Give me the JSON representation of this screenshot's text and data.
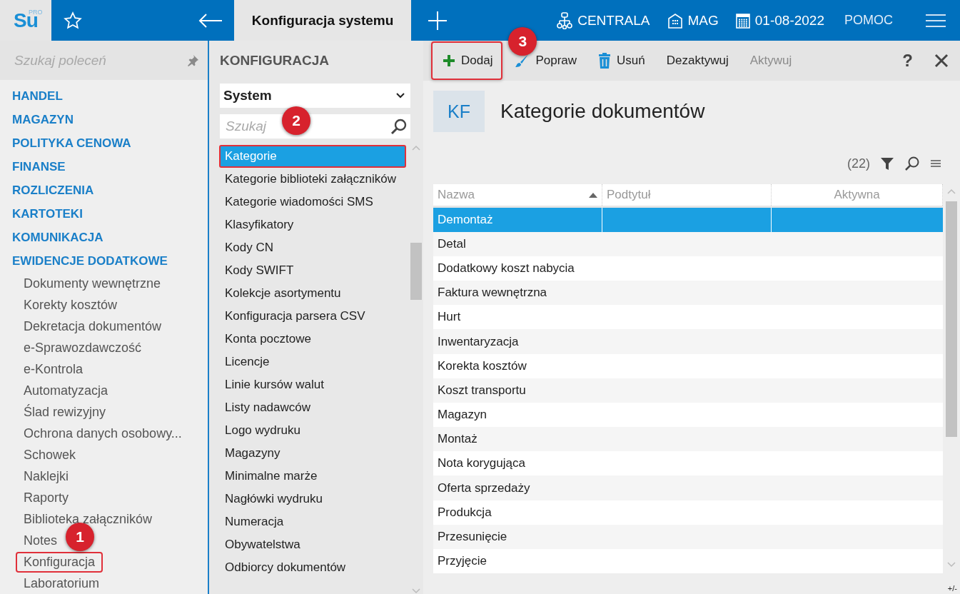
{
  "topbar": {
    "logo": "Su",
    "logo_sup": "PRO",
    "tab_title": "Konfiguracja systemu",
    "branch": "CENTRALA",
    "warehouse": "MAG",
    "date": "01-08-2022",
    "help": "POMOC"
  },
  "sidebar": {
    "search_placeholder": "Szukaj poleceń",
    "sections": [
      {
        "label": "HANDEL"
      },
      {
        "label": "MAGAZYN"
      },
      {
        "label": "POLITYKA CENOWA"
      },
      {
        "label": "FINANSE"
      },
      {
        "label": "ROZLICZENIA"
      },
      {
        "label": "KARTOTEKI"
      },
      {
        "label": "KOMUNIKACJA"
      },
      {
        "label": "EWIDENCJE DODATKOWE",
        "children": [
          {
            "label": "Dokumenty wewnętrzne",
            "outlined": false
          },
          {
            "label": "Korekty kosztów",
            "outlined": false
          },
          {
            "label": "Dekretacja dokumentów",
            "outlined": false
          },
          {
            "label": "e-Sprawozdawczość",
            "outlined": false
          },
          {
            "label": "e-Kontrola",
            "outlined": false
          },
          {
            "label": "Automatyzacja",
            "outlined": false
          },
          {
            "label": "Ślad rewizyjny",
            "outlined": false
          },
          {
            "label": "Ochrona danych osobowy...",
            "outlined": false
          },
          {
            "label": "Schowek",
            "outlined": false
          },
          {
            "label": "Naklejki",
            "outlined": false
          },
          {
            "label": "Raporty",
            "outlined": false
          },
          {
            "label": "Biblioteka załączników",
            "outlined": false
          },
          {
            "label": "Notes",
            "outlined": false
          },
          {
            "label": "Konfiguracja",
            "outlined": true,
            "callout": "1"
          },
          {
            "label": "Laboratorium",
            "outlined": false
          }
        ]
      }
    ]
  },
  "config": {
    "title": "KONFIGURACJA",
    "select_value": "System",
    "search_placeholder": "Szukaj",
    "items": [
      {
        "label": "Kategorie",
        "selected": true,
        "outlined": true,
        "callout": "2"
      },
      {
        "label": "Kategorie biblioteki załączników",
        "selected": false,
        "outlined": false
      },
      {
        "label": "Kategorie wiadomości SMS",
        "selected": false,
        "outlined": false
      },
      {
        "label": "Klasyfikatory",
        "selected": false,
        "outlined": false
      },
      {
        "label": "Kody CN",
        "selected": false,
        "outlined": false
      },
      {
        "label": "Kody SWIFT",
        "selected": false,
        "outlined": false
      },
      {
        "label": "Kolekcje asortymentu",
        "selected": false,
        "outlined": false
      },
      {
        "label": "Konfiguracja parsera CSV",
        "selected": false,
        "outlined": false
      },
      {
        "label": "Konta pocztowe",
        "selected": false,
        "outlined": false
      },
      {
        "label": "Licencje",
        "selected": false,
        "outlined": false
      },
      {
        "label": "Linie kursów walut",
        "selected": false,
        "outlined": false
      },
      {
        "label": "Listy nadawców",
        "selected": false,
        "outlined": false
      },
      {
        "label": "Logo wydruku",
        "selected": false,
        "outlined": false
      },
      {
        "label": "Magazyny",
        "selected": false,
        "outlined": false
      },
      {
        "label": "Minimalne marże",
        "selected": false,
        "outlined": false
      },
      {
        "label": "Nagłówki wydruku",
        "selected": false,
        "outlined": false
      },
      {
        "label": "Numeracja",
        "selected": false,
        "outlined": false
      },
      {
        "label": "Obywatelstwa",
        "selected": false,
        "outlined": false
      },
      {
        "label": "Odbiorcy dokumentów",
        "selected": false,
        "outlined": false
      }
    ]
  },
  "toolbar": {
    "actions": [
      {
        "kind": "plus",
        "label": "Dodaj",
        "disabled": false,
        "outlined": true,
        "callout": "3"
      },
      {
        "kind": "brush",
        "label": "Popraw",
        "disabled": false,
        "outlined": false
      },
      {
        "kind": "trash",
        "label": "Usuń",
        "disabled": false,
        "outlined": false
      },
      {
        "kind": "text",
        "label": "Dezaktywuj",
        "disabled": false,
        "outlined": false
      },
      {
        "kind": "text",
        "label": "Aktywuj",
        "disabled": true,
        "outlined": false
      }
    ],
    "help": "?"
  },
  "header": {
    "badge": "KF",
    "title": "Kategorie dokumentów",
    "count": "(22)"
  },
  "table": {
    "columns": [
      {
        "label": "Nazwa",
        "sorted": true
      },
      {
        "label": "Podtytuł",
        "sorted": false
      },
      {
        "label": "Aktywna",
        "sorted": false
      }
    ],
    "rows": [
      {
        "name": "Demontaż",
        "selected": true
      },
      {
        "name": "Detal",
        "selected": false
      },
      {
        "name": "Dodatkowy koszt nabycia",
        "selected": false
      },
      {
        "name": "Faktura wewnętrzna",
        "selected": false
      },
      {
        "name": "Hurt",
        "selected": false
      },
      {
        "name": "Inwentaryzacja",
        "selected": false
      },
      {
        "name": "Korekta kosztów",
        "selected": false
      },
      {
        "name": "Koszt transportu",
        "selected": false
      },
      {
        "name": "Magazyn",
        "selected": false
      },
      {
        "name": "Montaż",
        "selected": false
      },
      {
        "name": "Nota korygująca",
        "selected": false
      },
      {
        "name": "Oferta sprzedaży",
        "selected": false
      },
      {
        "name": "Produkcja",
        "selected": false
      },
      {
        "name": "Przesunięcie",
        "selected": false
      },
      {
        "name": "Przyjęcie",
        "selected": false
      }
    ]
  },
  "footer": {
    "toggle": "+/-"
  }
}
